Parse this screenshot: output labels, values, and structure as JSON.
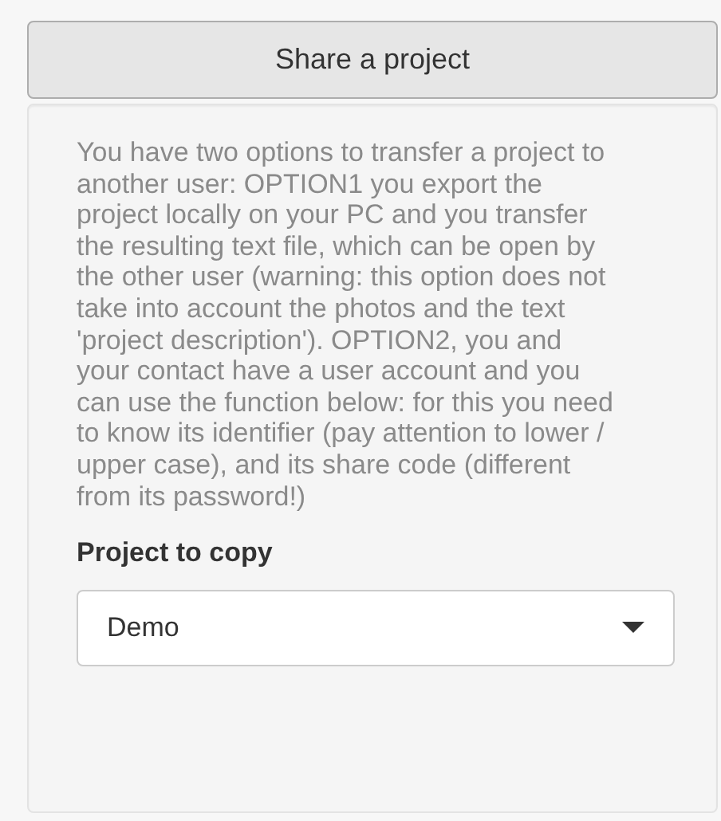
{
  "share_button": {
    "label": "Share a project"
  },
  "description": "You have two options to transfer a project to another user: OPTION1 you export the project locally on your PC and you transfer the resulting text file, which can be open by the other user (warning: this option does not take into account the photos and the text 'project description'). OPTION2, you and your contact have a user account and you can use the function below: for this you need to know its identifier (pay attention to lower / upper case), and its share code (different from its password!)",
  "project_select": {
    "label": "Project to copy",
    "value": "Demo"
  }
}
